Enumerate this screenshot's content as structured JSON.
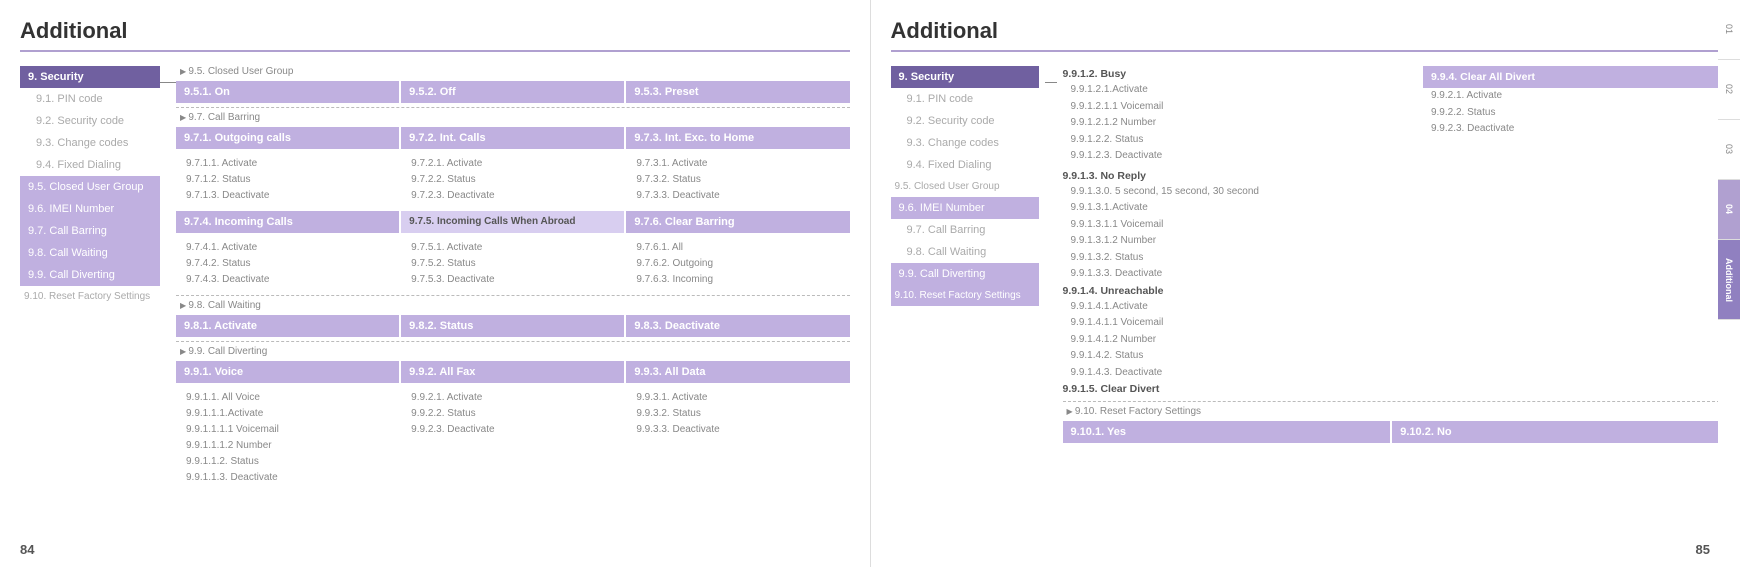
{
  "left_page": {
    "title": "Additional",
    "page_num": "84",
    "sidebar": {
      "items": [
        {
          "label": "9. Security",
          "active": true
        },
        {
          "label": "9.1. PIN code",
          "active": false
        },
        {
          "label": "9.2. Security code",
          "active": false
        },
        {
          "label": "9.3. Change codes",
          "active": false
        },
        {
          "label": "9.4. Fixed Dialing",
          "active": false
        },
        {
          "label": "9.5. Closed User Group",
          "highlighted": true
        },
        {
          "label": "9.6. IMEI Number",
          "highlighted": true
        },
        {
          "label": "9.7. Call Barring",
          "highlighted": true
        },
        {
          "label": "9.8. Call Waiting",
          "highlighted": true
        },
        {
          "label": "9.9. Call Diverting",
          "highlighted": true
        },
        {
          "label": "9.10. Reset Factory Settings",
          "active": false
        }
      ]
    },
    "section_95": {
      "label": "9.5. Closed User Group",
      "cols": [
        {
          "label": "9.5.1. On"
        },
        {
          "label": "9.5.2. Off"
        },
        {
          "label": "9.5.3. Preset"
        }
      ]
    },
    "section_97": {
      "label": "9.7. Call Barring",
      "row1": [
        {
          "label": "9.7.1. Outgoing calls"
        },
        {
          "label": "9.7.2. Int. Calls"
        },
        {
          "label": "9.7.3. Int. Exc. to Home"
        }
      ],
      "sub1": [
        [
          "9.7.1.1. Activate",
          "9.7.2.1. Activate",
          "9.7.3.1. Activate"
        ],
        [
          "9.7.1.2. Status",
          "9.7.2.2. Status",
          "9.7.3.2. Status"
        ],
        [
          "9.7.1.3. Deactivate",
          "9.7.2.3. Deactivate",
          "9.7.3.3. Deactivate"
        ]
      ],
      "row2": [
        {
          "label": "9.7.4. Incoming Calls"
        },
        {
          "label": "9.7.5. Incoming Calls When Abroad",
          "lighter": true
        },
        {
          "label": "9.7.6. Clear Barring"
        }
      ],
      "sub2": [
        [
          "9.7.4.1. Activate",
          "9.7.5.1. Activate",
          "9.7.6.1. All"
        ],
        [
          "9.7.4.2. Status",
          "9.7.5.2. Status",
          "9.7.6.2. Outgoing"
        ],
        [
          "9.7.4.3. Deactivate",
          "9.7.5.3. Deactivate",
          "9.7.6.3. Incoming"
        ]
      ]
    },
    "section_98": {
      "label": "9.8. Call Waiting",
      "cols": [
        {
          "label": "9.8.1. Activate"
        },
        {
          "label": "9.8.2. Status"
        },
        {
          "label": "9.8.3. Deactivate"
        }
      ]
    },
    "section_99": {
      "label": "9.9. Call Diverting",
      "row1": [
        {
          "label": "9.9.1. Voice"
        },
        {
          "label": "9.9.2. All Fax"
        },
        {
          "label": "9.9.3. All Data"
        }
      ],
      "sub_voice": [
        "9.9.1.1. All Voice",
        "9.9.1.1.1.Activate",
        "9.9.1.1.1.1 Voicemail",
        "9.9.1.1.1.2 Number",
        "9.9.1.1.2. Status",
        "9.9.1.1.3. Deactivate"
      ],
      "sub_fax": [
        "9.9.2.1. Activate",
        "9.9.2.2. Status",
        "9.9.2.3. Deactivate"
      ],
      "sub_data": [
        "9.9.3.1. Activate",
        "9.9.3.2. Status",
        "9.9.3.3. Deactivate"
      ]
    }
  },
  "right_page": {
    "title": "Additional",
    "page_num": "85",
    "sidebar": {
      "items": [
        {
          "label": "9. Security",
          "active": true
        },
        {
          "label": "9.1. PIN code",
          "active": false
        },
        {
          "label": "9.2. Security code",
          "active": false
        },
        {
          "label": "9.3. Change codes",
          "active": false
        },
        {
          "label": "9.4. Fixed Dialing",
          "active": false
        },
        {
          "label": "9.5. Closed User Group",
          "active": false
        },
        {
          "label": "9.6. IMEI Number",
          "highlighted": true
        },
        {
          "label": "9.7. Call Barring",
          "active": false
        },
        {
          "label": "9.8. Call Waiting",
          "active": false
        },
        {
          "label": "9.9. Call Diverting",
          "highlighted": true
        },
        {
          "label": "9.10. Reset Factory Settings",
          "highlighted": true
        }
      ]
    },
    "section_991": {
      "label_busy": "9.9.1.2. Busy",
      "busy_detail": [
        "9.9.1.2.1.Activate",
        "9.9.1.2.1.1 Voicemail",
        "9.9.1.2.1.2 Number",
        "9.9.1.2.2. Status",
        "9.9.1.2.3. Deactivate"
      ],
      "label_994": "9.9.4. Clear All Divert",
      "clear_detail": [
        "9.9.2.1. Activate",
        "9.9.2.2. Status",
        "9.9.2.3. Deactivate"
      ],
      "label_noreply": "9.9.1.3. No Reply",
      "noreply_detail": [
        "9.9.1.3.0. 5 second, 15 second, 30 second",
        "9.9.1.3.1.Activate",
        "9.9.1.3.1.1 Voicemail",
        "9.9.1.3.1.2 Number",
        "9.9.1.3.2. Status",
        "9.9.1.3.3. Deactivate"
      ],
      "label_unreachable": "9.9.1.4. Unreachable",
      "unreachable_detail": [
        "9.9.1.4.1.Activate",
        "9.9.1.4.1.1 Voicemail",
        "9.9.1.4.1.2 Number",
        "9.9.1.4.2. Status",
        "9.9.1.4.3. Deactivate"
      ],
      "label_cleardivert": "9.9.1.5. Clear Divert"
    },
    "section_910": {
      "label": "9.10. Reset Factory Settings",
      "cols": [
        {
          "label": "9.10.1. Yes"
        },
        {
          "label": "9.10.2. No"
        }
      ]
    }
  },
  "side_tabs": [
    {
      "label": "01"
    },
    {
      "label": "02"
    },
    {
      "label": "03"
    },
    {
      "label": "04",
      "active": true
    },
    {
      "label": "Additional",
      "active": true,
      "vertical": true
    }
  ]
}
